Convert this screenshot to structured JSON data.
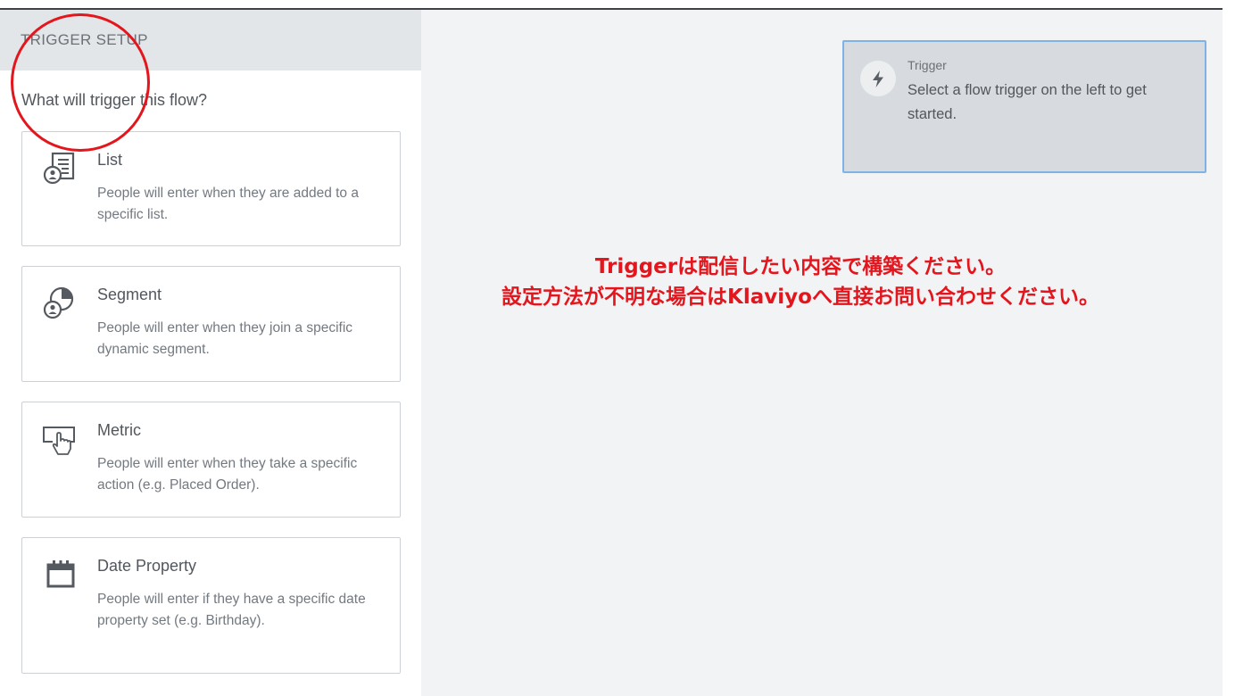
{
  "sidebar": {
    "header": "TRIGGER SETUP",
    "question": "What will trigger this flow?",
    "cards": [
      {
        "title": "List",
        "desc": "People will enter when they are added to a specific list.",
        "icon": "list-icon"
      },
      {
        "title": "Segment",
        "desc": "People will enter when they join a specific dynamic segment.",
        "icon": "segment-icon"
      },
      {
        "title": "Metric",
        "desc": "People will enter when they take a specific action (e.g. Placed Order).",
        "icon": "metric-icon"
      },
      {
        "title": "Date Property",
        "desc": "People will enter if they have a specific date property set (e.g. Birthday).",
        "icon": "calendar-icon"
      }
    ]
  },
  "node": {
    "label": "Trigger",
    "text": "Select a flow trigger on the left to get started.",
    "icon": "lightning-icon"
  },
  "annotation": {
    "line1": "Triggerは配信したい内容で構築ください。",
    "line2": "設定方法が不明な場合はKlaviyoへ直接お問い合わせください。"
  },
  "colors": {
    "annotation": "#e3161e",
    "node_border": "#7fb3e6",
    "canvas_bg": "#f2f3f5",
    "header_bg": "#e3e6e9"
  }
}
